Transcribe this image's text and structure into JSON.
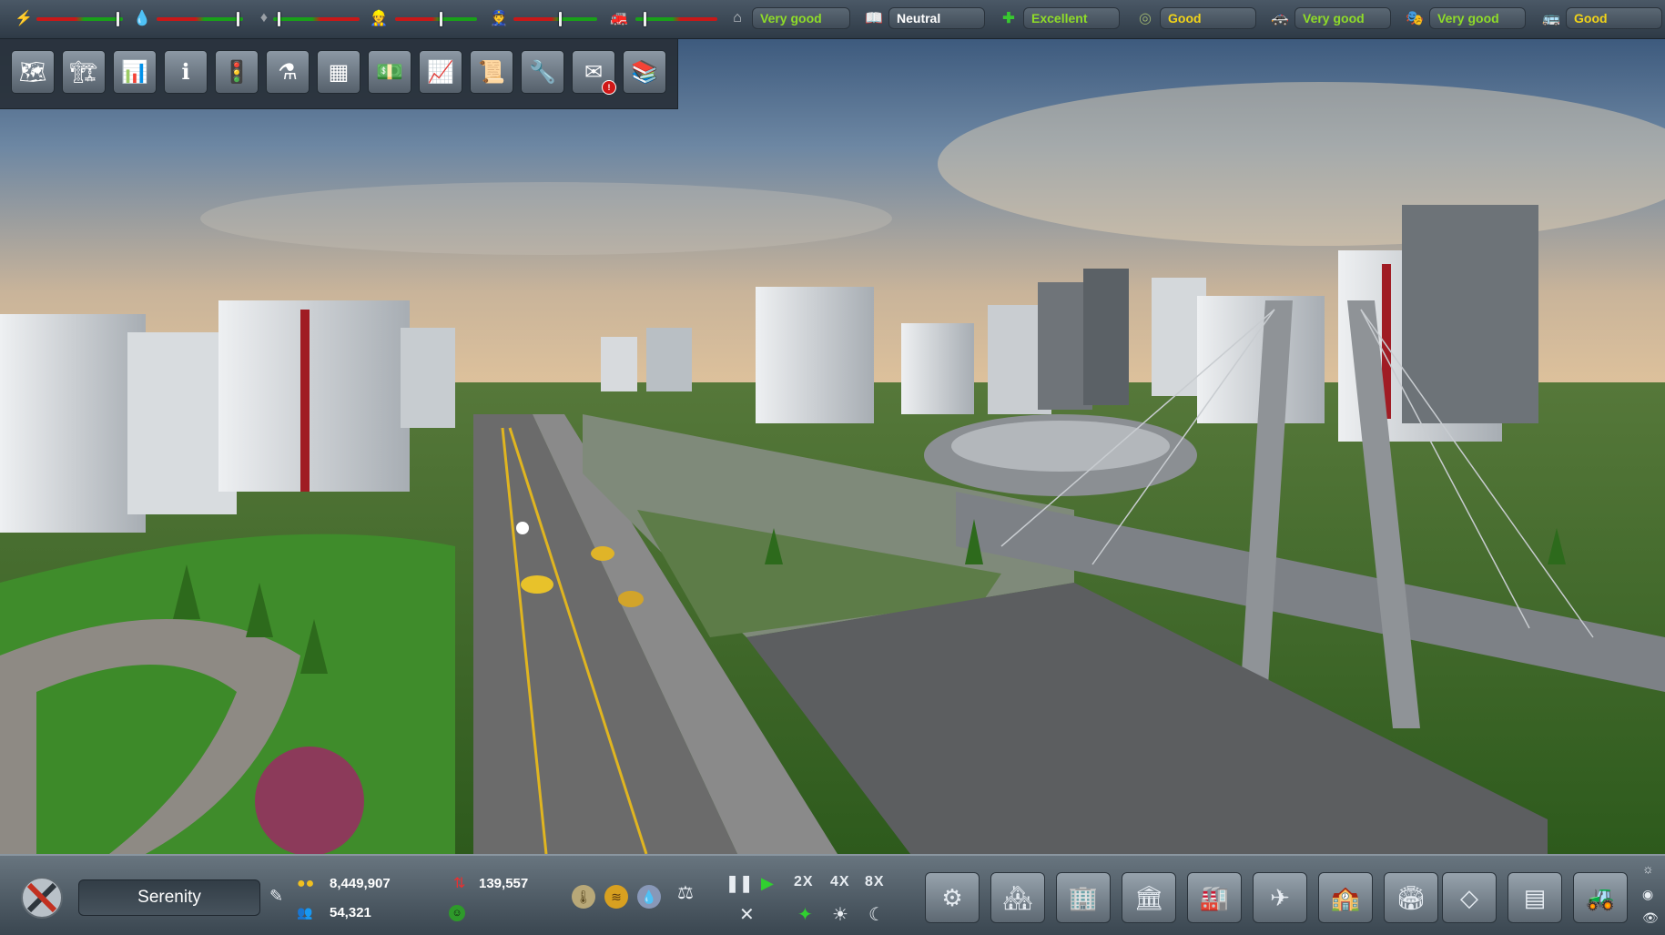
{
  "top_bar": {
    "meters": [
      {
        "icon": "electricity-icon",
        "glyph": "⚡",
        "level": 0.85
      },
      {
        "icon": "water-drop-icon",
        "glyph": "💧",
        "level": 0.88
      },
      {
        "icon": "waste-bag-icon",
        "glyph": "♦",
        "level": 0.05
      },
      {
        "icon": "workers-icon",
        "glyph": "👷",
        "level": 0.55
      },
      {
        "icon": "police-icon",
        "glyph": "👮",
        "level": 0.55
      },
      {
        "icon": "fire-icon",
        "glyph": "🚒",
        "level": 0.1
      }
    ],
    "ratings": [
      {
        "icon": "housing-icon",
        "glyph": "⌂",
        "label": "Very good"
      },
      {
        "icon": "education-icon",
        "glyph": "📖",
        "label": "Neutral"
      },
      {
        "icon": "health-icon",
        "glyph": "✚",
        "label": "Excellent"
      },
      {
        "icon": "environment-icon",
        "glyph": "◎",
        "label": "Good"
      },
      {
        "icon": "safety-icon",
        "glyph": "🚓",
        "label": "Very good"
      },
      {
        "icon": "entertainment-icon",
        "glyph": "🎭",
        "label": "Very good"
      },
      {
        "icon": "transport-icon",
        "glyph": "🚌",
        "label": "Good"
      }
    ]
  },
  "advisors": [
    {
      "icon": "terrain-map-icon",
      "glyph": "🗺"
    },
    {
      "icon": "building-blocks-icon",
      "glyph": "🏗"
    },
    {
      "icon": "city-statistics-icon",
      "glyph": "📊"
    },
    {
      "icon": "info-icon",
      "glyph": "ℹ"
    },
    {
      "icon": "traffic-icon",
      "glyph": "🚦"
    },
    {
      "icon": "research-flask-icon",
      "glyph": "⚗"
    },
    {
      "icon": "solar-panels-icon",
      "glyph": "▦"
    },
    {
      "icon": "finance-icon",
      "glyph": "💵"
    },
    {
      "icon": "graph-icon",
      "glyph": "📈"
    },
    {
      "icon": "documents-icon",
      "glyph": "📜"
    },
    {
      "icon": "engineering-icon",
      "glyph": "🔧"
    },
    {
      "icon": "messages-icon",
      "glyph": "✉",
      "badge": "!"
    },
    {
      "icon": "library-icon",
      "glyph": "📚"
    }
  ],
  "bottom_bar": {
    "city_name": "Serenity",
    "money": "8,449,907",
    "population": "54,321",
    "income": "139,557",
    "speeds": {
      "x2": "2X",
      "x4": "4X",
      "x8": "8X"
    },
    "build_categories": [
      {
        "icon": "power-plant-icon"
      },
      {
        "icon": "residential-icon"
      },
      {
        "icon": "industrial-icon"
      },
      {
        "icon": "services-icon"
      },
      {
        "icon": "factory-icon"
      },
      {
        "icon": "airport-icon"
      },
      {
        "icon": "civic-building-icon"
      },
      {
        "icon": "landmark-icon"
      },
      {
        "icon": "greenhouse-icon"
      },
      {
        "icon": "storage-icon"
      },
      {
        "icon": "bulldozer-icon"
      }
    ]
  },
  "colors": {
    "rating_green": "#8fdc28",
    "rating_yellow": "#f2d418",
    "sky_top": "#3d5e85",
    "sky_horizon": "#e8c49a",
    "grass": "#3f8a2a",
    "road": "#6b6b6b"
  }
}
